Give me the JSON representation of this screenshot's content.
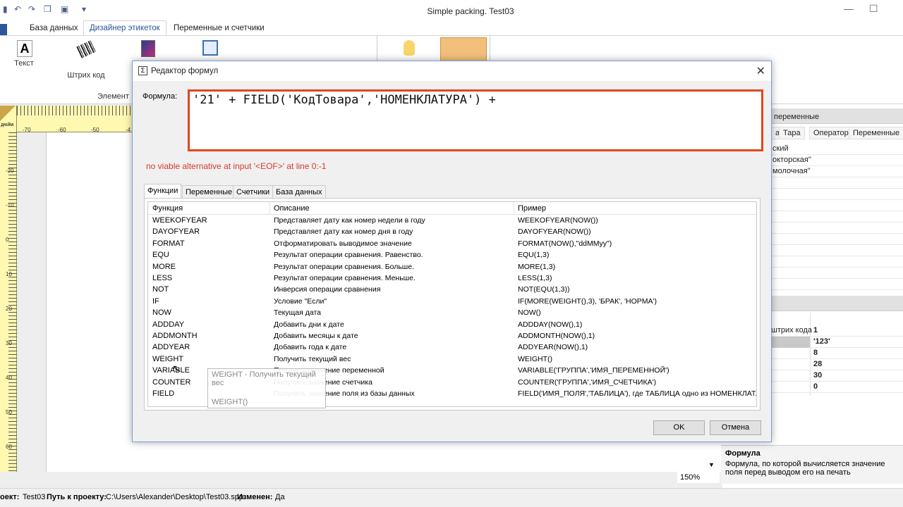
{
  "window": {
    "title": "Simple packing. Test03"
  },
  "ribbon": {
    "tabs": [
      "База данных",
      "Дизайнер этикеток",
      "Переменные и счетчики"
    ],
    "tools": {
      "text_label": "Текст",
      "barcode_label": "Штрих код",
      "group_label": "Элемент"
    }
  },
  "ruler": {
    "unit": "дюйм",
    "h_ticks": [
      "-70",
      "-60",
      "-50",
      "-4"
    ],
    "v_ticks": [
      "-20",
      "-10",
      "0",
      "10",
      "20",
      "30",
      "40",
      "50",
      "60"
    ]
  },
  "right_panel": {
    "header": "переменные",
    "tabs": [
      "а",
      "Тара",
      "Оператор",
      "Переменные"
    ],
    "list_items": [
      "ский",
      "окторская\"",
      "молочная\""
    ],
    "props": [
      {
        "name": "штрих кода",
        "value": "1"
      },
      {
        "name": "",
        "value": "'123'"
      },
      {
        "name": "",
        "value": "8"
      },
      {
        "name": "",
        "value": "28"
      },
      {
        "name": "",
        "value": "30"
      },
      {
        "name": "",
        "value": "0"
      }
    ],
    "zoom": "150%",
    "help_title": "Формула",
    "help_text": "Формула, по которой вычисляется значение поля перед выводом его на печать"
  },
  "status": {
    "project_label": "оект:",
    "project_value": "Test03",
    "path_label": "Путь к проекту:",
    "path_value": "C:\\Users\\Alexander\\Desktop\\Test03.spp",
    "changed_label": "Изменен:",
    "changed_value": "Да"
  },
  "dialog": {
    "title": "Редактор формул",
    "formula_label": "Формула:",
    "formula": "'21' + FIELD('КодТовара','НОМЕНКЛАТУРА') +",
    "error": "no viable alternative at input '<EOF>' at line 0:-1",
    "tabs": [
      "Функции",
      "Переменные",
      "Счетчики",
      "База данных"
    ],
    "headers": {
      "fn": "Функция",
      "desc": "Описание",
      "example": "Пример"
    },
    "rows": [
      {
        "fn": "WEEKOFYEAR",
        "desc": "Представляет дату как номер недели в году",
        "example": "WEEKOFYEAR(NOW())"
      },
      {
        "fn": "DAYOFYEAR",
        "desc": "Представляет дату как номер дня в году",
        "example": "DAYOFYEAR(NOW())"
      },
      {
        "fn": "FORMAT",
        "desc": "Отформатировать выводимое значение",
        "example": "FORMAT(NOW(),\"ddMMyy\")"
      },
      {
        "fn": "EQU",
        "desc": "Результат операции сравнения. Равенство.",
        "example": "EQU(1,3)"
      },
      {
        "fn": "MORE",
        "desc": "Результат операции сравнения. Больше.",
        "example": "MORE(1,3)"
      },
      {
        "fn": "LESS",
        "desc": "Результат операции сравнения. Меньше.",
        "example": "LESS(1,3)"
      },
      {
        "fn": "NOT",
        "desc": "Инверсия операции сравнения",
        "example": "NOT(EQU(1,3))"
      },
      {
        "fn": "IF",
        "desc": "Условие \"Если\"",
        "example": "IF(MORE(WEIGHT(),3), 'БРАК', 'НОРМА')"
      },
      {
        "fn": "NOW",
        "desc": "Текущая дата",
        "example": "NOW()"
      },
      {
        "fn": "ADDDAY",
        "desc": "Добавить дни к дате",
        "example": "ADDDAY(NOW(),1)"
      },
      {
        "fn": "ADDMONTH",
        "desc": "Добавить месяцы к дате",
        "example": "ADDMONTH(NOW(),1)"
      },
      {
        "fn": "ADDYEAR",
        "desc": "Добавить года к дате",
        "example": "ADDYEAR(NOW(),1)"
      },
      {
        "fn": "WEIGHT",
        "desc": "Получить текущий вес",
        "example": "WEIGHT()"
      },
      {
        "fn": "VARIABLE",
        "desc": "Получить значение переменной",
        "example": "VARIABLE('ГРУППА','ИМЯ_ПЕРЕМЕННОЙ')"
      },
      {
        "fn": "COUNTER",
        "desc": "Получить значение счетчика",
        "example": "COUNTER('ГРУППА','ИМЯ_СЧЕТЧИКА')"
      },
      {
        "fn": "FIELD",
        "desc": "Получить значение поля из базы данных",
        "example": "FIELD('ИМЯ_ПОЛЯ','ТАБЛИЦА'), где ТАБЛИЦА одно из НОМЕНКЛАТ..."
      }
    ],
    "tooltip": {
      "line1": "WEIGHT - Получить текущий вес",
      "line2": "WEIGHT()"
    },
    "ok_label": "OK",
    "cancel_label": "Отмена"
  }
}
